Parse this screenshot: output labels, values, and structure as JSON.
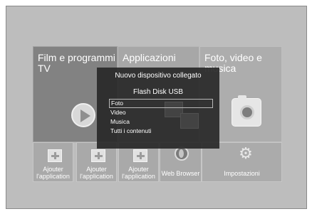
{
  "tiles": {
    "movies": {
      "title": "Film e programmi TV",
      "icon": "play-icon"
    },
    "apps": {
      "title": "Applicazioni"
    },
    "photos": {
      "title": "Foto, video e musica",
      "icon": "camera-icon"
    }
  },
  "bottom_row": {
    "add_app_label": "Ajouter l'application",
    "web_browser": "Web Browser",
    "settings": "Impostazioni"
  },
  "popup": {
    "title": "Nuovo dispositivo collegato",
    "device": "Flash Disk USB",
    "items": [
      "Foto",
      "Video",
      "Musica",
      "Tutti i contenuti"
    ],
    "selected_index": 0
  },
  "colors": {
    "background": "#bdbdbd",
    "popup": "#282828",
    "tile_active": "#828282"
  }
}
